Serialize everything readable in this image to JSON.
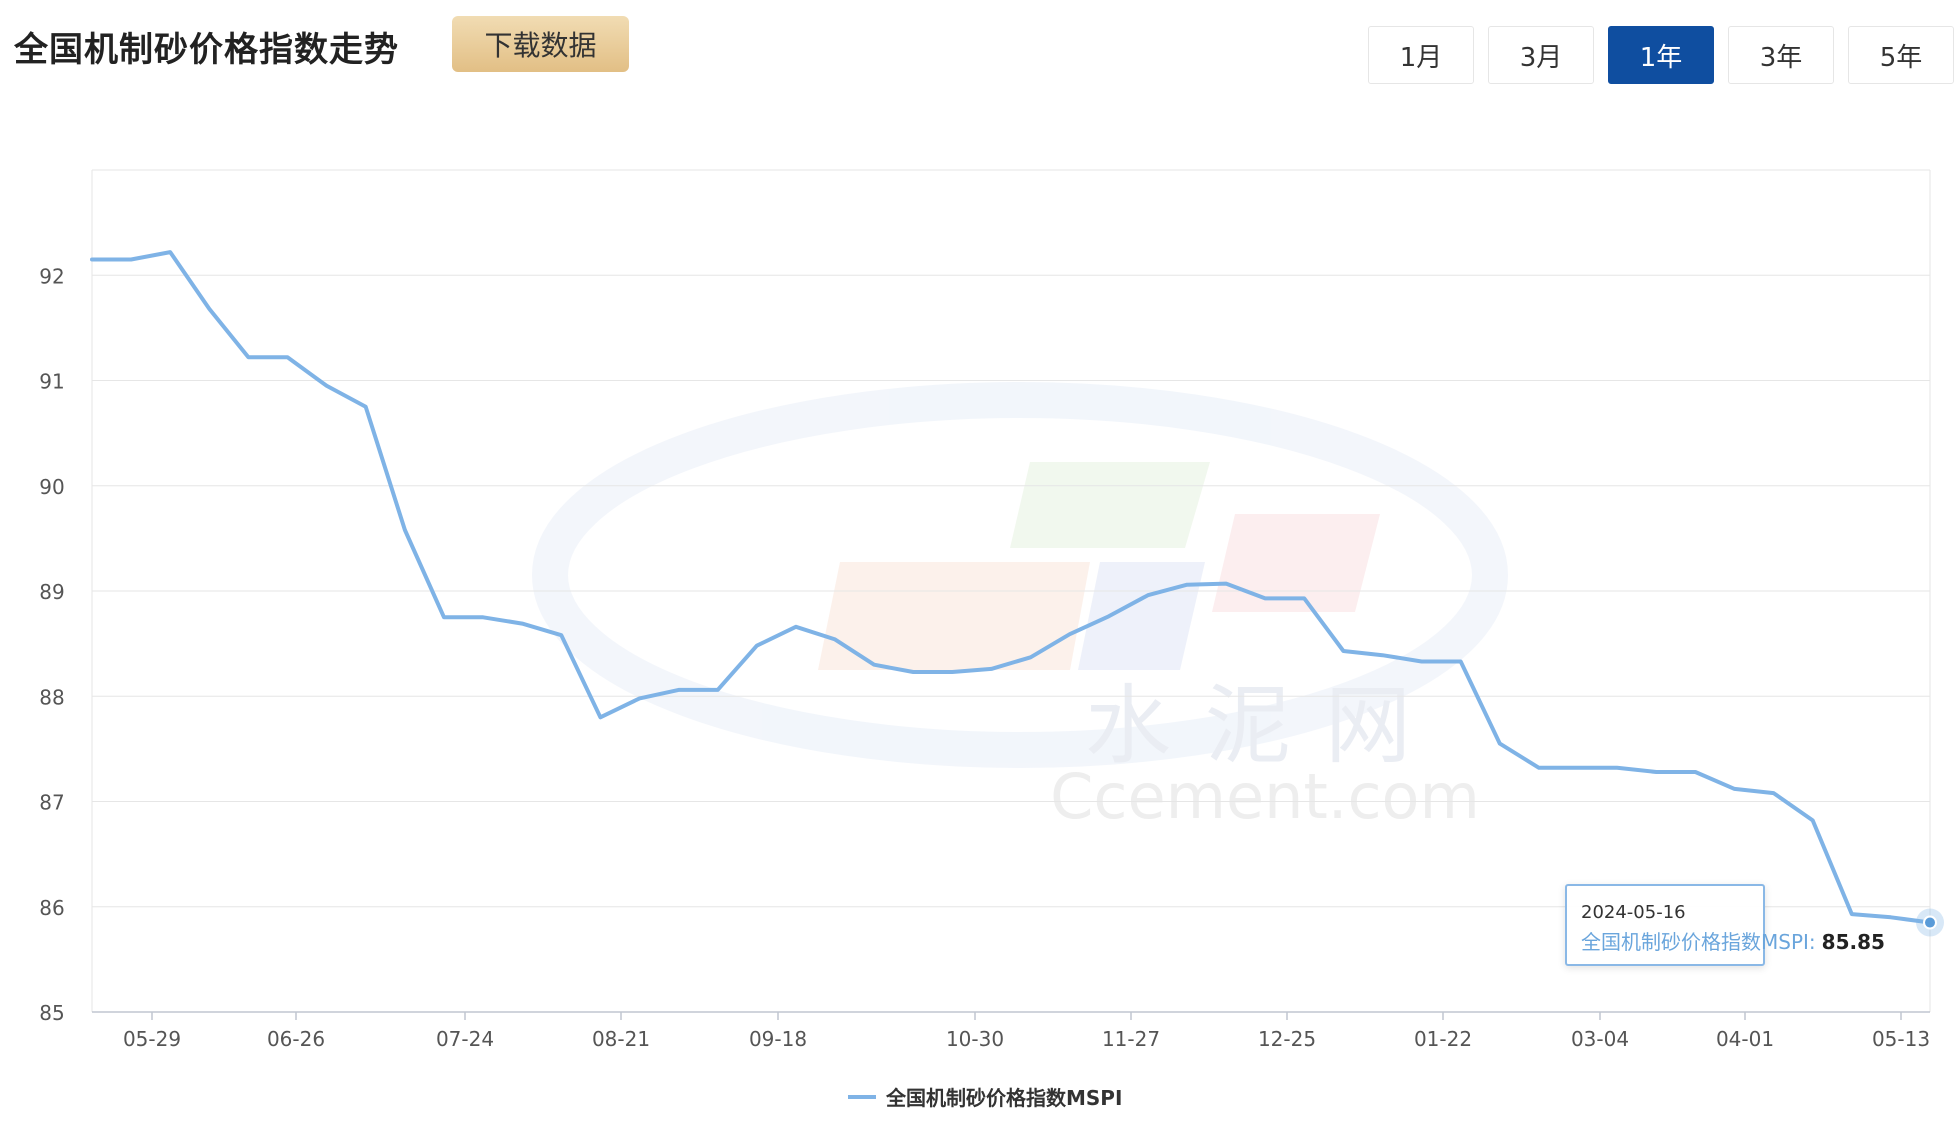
{
  "header": {
    "title": "全国机制砂价格指数走势",
    "download_label": "下载数据",
    "ranges": [
      {
        "label": "1月",
        "active": false
      },
      {
        "label": "3月",
        "active": false
      },
      {
        "label": "1年",
        "active": true
      },
      {
        "label": "3年",
        "active": false
      },
      {
        "label": "5年",
        "active": false
      }
    ]
  },
  "watermark": {
    "cn": "水泥网",
    "en": "Ccement.com"
  },
  "tooltip": {
    "date": "2024-05-16",
    "label": "全国机制砂价格指数MSPI:",
    "value": "85.85"
  },
  "colors": {
    "line": "#7fb3e6",
    "accent": "#0f4ea0",
    "grid": "#e6e6e6"
  },
  "chart_data": {
    "type": "line",
    "title": "",
    "xlabel": "",
    "ylabel": "",
    "ylim": [
      85,
      93
    ],
    "yticks": [
      85,
      86,
      87,
      88,
      89,
      90,
      91,
      92
    ],
    "x_tick_labels": [
      "05-29",
      "06-26",
      "07-24",
      "08-21",
      "09-18",
      "10-30",
      "11-27",
      "12-25",
      "01-22",
      "03-04",
      "04-01",
      "05-13"
    ],
    "legend_position": "bottom-center",
    "grid": true,
    "series": [
      {
        "name": "全国机制砂价格指数MSPI",
        "values": [
          92.15,
          92.15,
          92.22,
          91.68,
          91.22,
          91.22,
          90.95,
          90.75,
          89.58,
          88.75,
          88.75,
          88.69,
          88.58,
          87.8,
          87.98,
          88.06,
          88.06,
          88.48,
          88.66,
          88.54,
          88.3,
          88.23,
          88.23,
          88.26,
          88.37,
          88.59,
          88.76,
          88.96,
          89.06,
          89.07,
          88.93,
          88.93,
          88.43,
          88.39,
          88.33,
          88.33,
          87.55,
          87.32,
          87.32,
          87.32,
          87.28,
          87.28,
          87.12,
          87.08,
          86.82,
          85.93,
          85.9,
          85.85
        ]
      }
    ]
  }
}
